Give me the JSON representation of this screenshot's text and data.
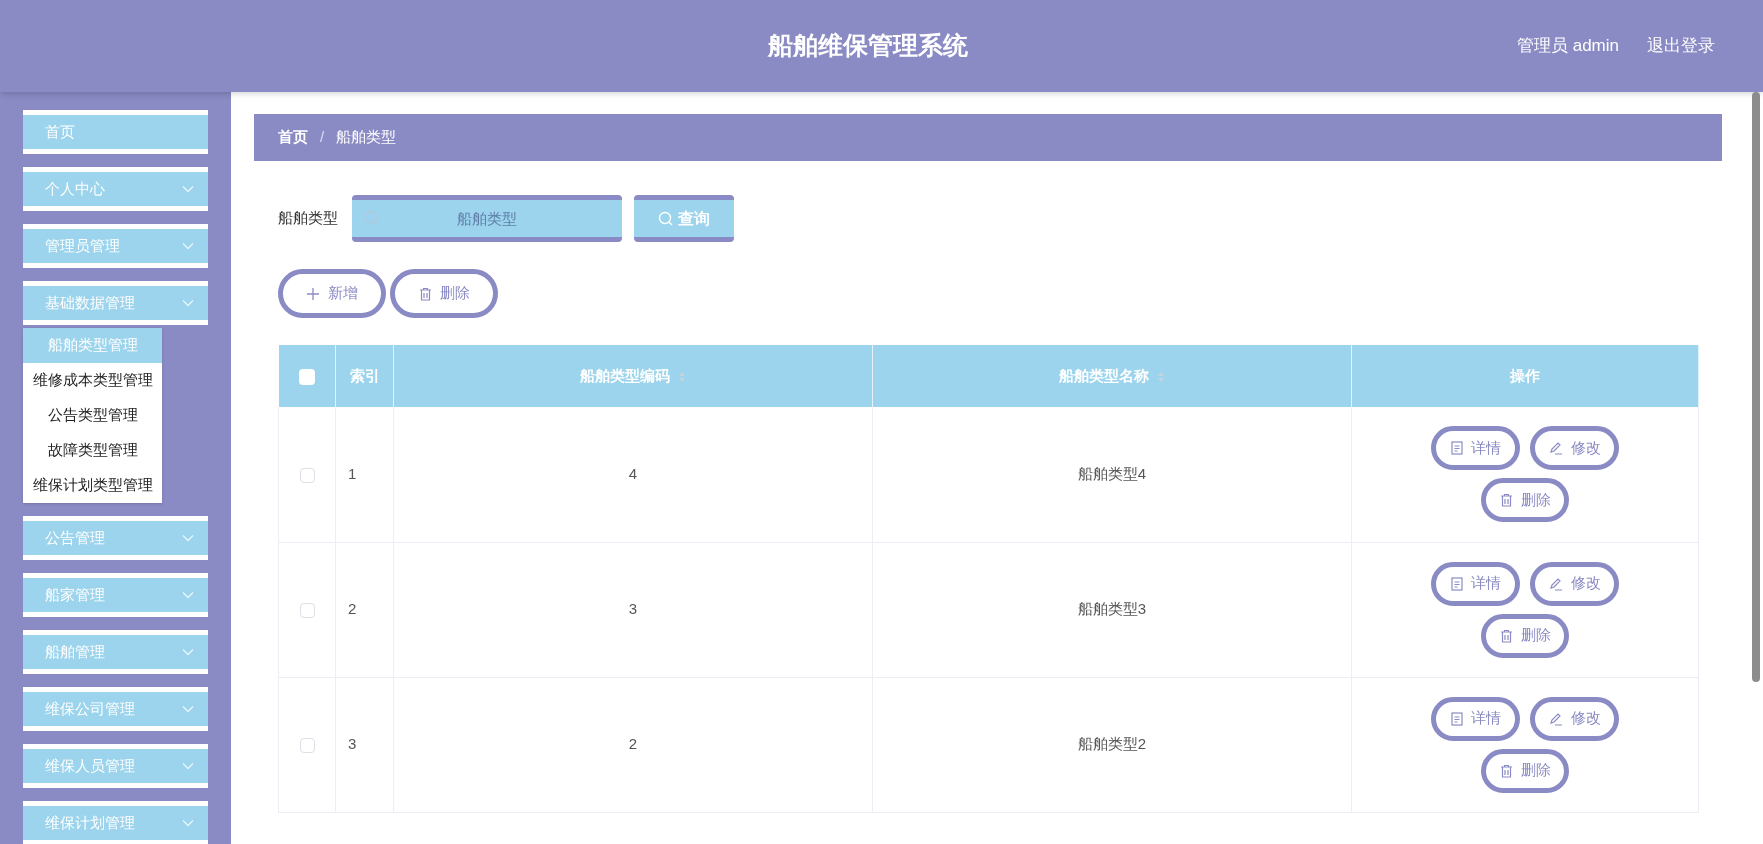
{
  "header": {
    "title": "船舶维保管理系统",
    "user": "管理员 admin",
    "logout": "退出登录"
  },
  "sidebar": {
    "items": [
      {
        "label": "首页",
        "expandable": false,
        "expanded": false
      },
      {
        "label": "个人中心",
        "expandable": true,
        "expanded": false
      },
      {
        "label": "管理员管理",
        "expandable": true,
        "expanded": false
      },
      {
        "label": "基础数据管理",
        "expandable": true,
        "expanded": true,
        "children": [
          {
            "label": "船舶类型管理",
            "selected": true
          },
          {
            "label": "维修成本类型管理",
            "selected": false
          },
          {
            "label": "公告类型管理",
            "selected": false
          },
          {
            "label": "故障类型管理",
            "selected": false
          },
          {
            "label": "维保计划类型管理",
            "selected": false
          }
        ]
      },
      {
        "label": "公告管理",
        "expandable": true,
        "expanded": false
      },
      {
        "label": "船家管理",
        "expandable": true,
        "expanded": false
      },
      {
        "label": "船舶管理",
        "expandable": true,
        "expanded": false
      },
      {
        "label": "维保公司管理",
        "expandable": true,
        "expanded": false
      },
      {
        "label": "维保人员管理",
        "expandable": true,
        "expanded": false
      },
      {
        "label": "维保计划管理",
        "expandable": true,
        "expanded": false
      }
    ]
  },
  "breadcrumb": {
    "items": [
      "首页",
      "船舶类型"
    ],
    "separator": "/"
  },
  "search": {
    "label": "船舶类型",
    "placeholder": "船舶类型",
    "button": "查询"
  },
  "toolbar": {
    "add": "新增",
    "delete": "删除"
  },
  "table": {
    "select_all": false,
    "columns": [
      "索引",
      "船舶类型编码",
      "船舶类型名称",
      "操作"
    ],
    "rows": [
      {
        "checked": false,
        "index": "1",
        "code": "4",
        "name": "船舶类型4",
        "actions": [
          "详情",
          "修改",
          "删除"
        ]
      },
      {
        "checked": false,
        "index": "2",
        "code": "3",
        "name": "船舶类型3",
        "actions": [
          "详情",
          "修改",
          "删除"
        ]
      },
      {
        "checked": false,
        "index": "3",
        "code": "2",
        "name": "船舶类型2",
        "actions": [
          "详情",
          "修改",
          "删除"
        ]
      }
    ]
  }
}
